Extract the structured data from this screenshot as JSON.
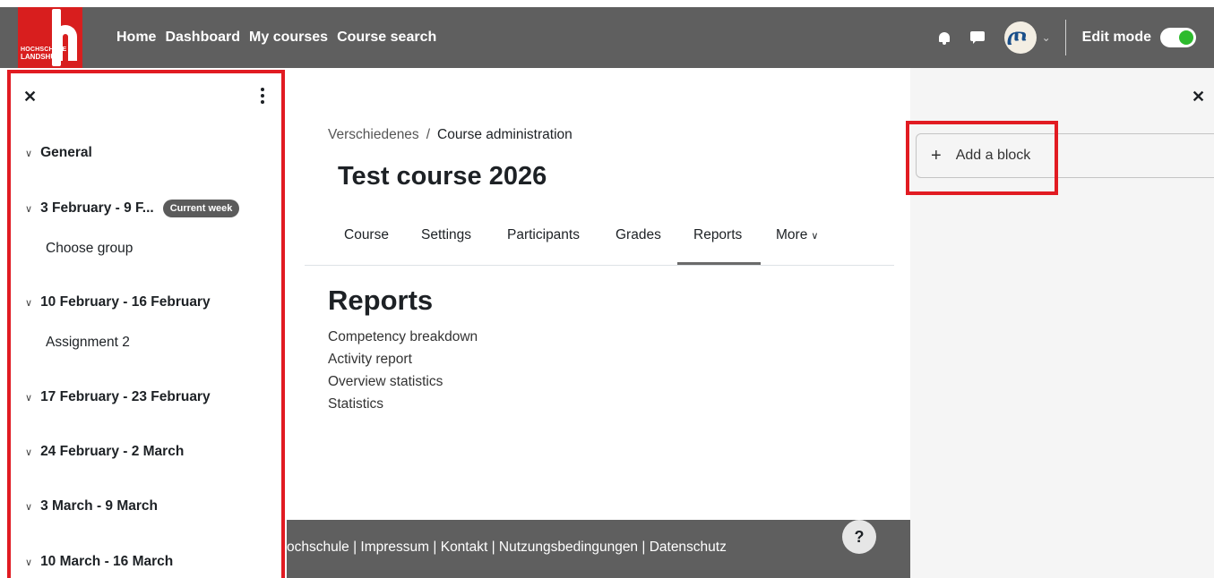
{
  "brand": {
    "logo_text_top": "HOCHSCHULE",
    "logo_text_bottom": "LANDSHUT"
  },
  "topnav": {
    "items": [
      "Home",
      "Dashboard",
      "My courses",
      "Course search"
    ]
  },
  "navright": {
    "edit_mode_label": "Edit mode",
    "edit_mode_on": true
  },
  "drawer": {
    "sections": [
      {
        "label": "General",
        "items": []
      },
      {
        "label": "3 February - 9 F...",
        "badge": "Current week",
        "items": [
          "Choose group"
        ]
      },
      {
        "label": "10 February - 16 February",
        "items": [
          "Assignment 2"
        ]
      },
      {
        "label": "17 February - 23 February",
        "items": []
      },
      {
        "label": "24 February - 2 March",
        "items": []
      },
      {
        "label": "3 March - 9 March",
        "items": []
      },
      {
        "label": "10 March - 16 March",
        "items": []
      }
    ]
  },
  "main": {
    "breadcrumb": [
      "Verschiedenes",
      "Course administration"
    ],
    "course_title": "Test course 2026",
    "tabs": [
      "Course",
      "Settings",
      "Participants",
      "Grades",
      "Reports",
      "More"
    ],
    "active_tab": "Reports",
    "heading": "Reports",
    "report_links": [
      "Competency breakdown",
      "Activity report",
      "Overview statistics",
      "Statistics"
    ]
  },
  "footer": {
    "links_text": "ochschule | Impressum | Kontakt | Nutzungsbedingungen | Datenschutz",
    "help_label": "?"
  },
  "right_drawer": {
    "add_block_label": "Add a block"
  },
  "colors": {
    "navbar": "#5f5f5f",
    "brand_red": "#d81e1e",
    "highlight": "#e11b22",
    "toggle_on": "#2dbb2d"
  }
}
